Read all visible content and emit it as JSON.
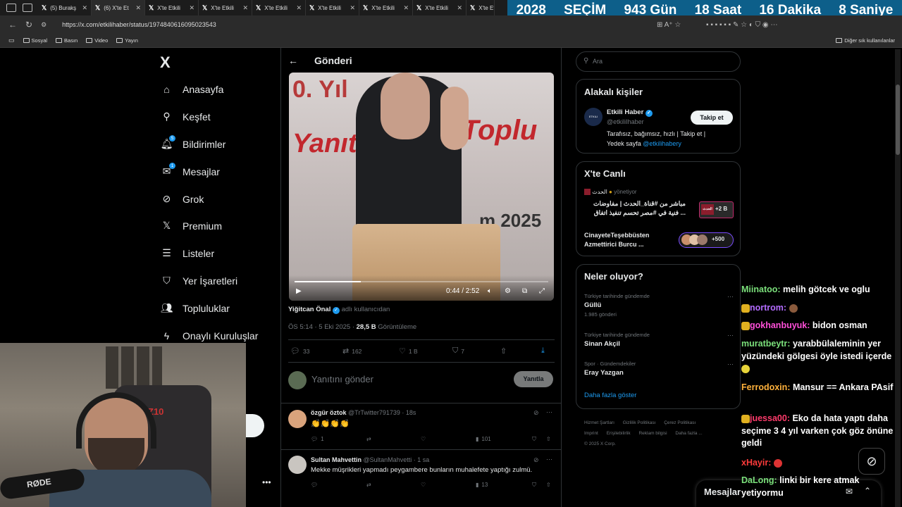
{
  "tabs": [
    {
      "label": "(5) Burakş"
    },
    {
      "label": "(6) X'te Et"
    },
    {
      "label": "X'te Etkili"
    },
    {
      "label": "X'te Etkili"
    },
    {
      "label": "X'te Etkili"
    },
    {
      "label": "X'te Etkili"
    },
    {
      "label": "X'te Etkili"
    },
    {
      "label": "X'te Etkili"
    },
    {
      "label": "X'te Etk"
    }
  ],
  "banner": {
    "year": "2028",
    "label": "SEÇİM",
    "days": "943 Gün",
    "hours": "18 Saat",
    "minutes": "16 Dakika",
    "seconds": "8 Saniye"
  },
  "browser": {
    "url": "https://x.com/etkilihaber/status/1974840616095023543"
  },
  "bookmarks": [
    "Sosyal",
    "Basın",
    "Video",
    "Yayın"
  ],
  "other_bookmarks": "Diğer sık kullanılanlar",
  "nav": {
    "logo": "X",
    "items": [
      {
        "label": "Anasayfa",
        "icon": "home-icon"
      },
      {
        "label": "Keşfet",
        "icon": "search-icon"
      },
      {
        "label": "Bildirimler",
        "icon": "bell-icon",
        "badge": "5"
      },
      {
        "label": "Mesajlar",
        "icon": "mail-icon",
        "badge": "1"
      },
      {
        "label": "Grok",
        "icon": "grok-icon"
      },
      {
        "label": "Premium",
        "icon": "x-icon"
      },
      {
        "label": "Listeler",
        "icon": "list-icon"
      },
      {
        "label": "Yer İşaretleri",
        "icon": "bookmark-icon"
      },
      {
        "label": "Topluluklar",
        "icon": "people-icon"
      },
      {
        "label": "Onaylı Kuruluşlar",
        "icon": "bolt-icon"
      }
    ]
  },
  "post": {
    "header": "Gönderi",
    "video_time": "0:44 / 2:52",
    "credit_name": "Yiğitcan Önal",
    "credit_suffix": "adlı kullanıcıdan",
    "timestamp": "ÖS 5:14 · 5 Eki 2025 ·",
    "views_count": "28,5 B",
    "views_label": "Görüntüleme",
    "stats": {
      "replies": "33",
      "reposts": "162",
      "likes": "1 B",
      "bookmarks": "7"
    },
    "reply_placeholder": "Yanıtını gönder",
    "reply_button": "Yanıtla"
  },
  "replies": [
    {
      "name": "özgür öztok",
      "handle": "@TrTwitter791739 · 18s",
      "text": "👏👏👏👏",
      "replies": "1",
      "views": "101"
    },
    {
      "name": "Sultan Mahvettin",
      "handle": "@SultanMahvetti · 1 sa",
      "text": "Mekke müşrikleri yapmadı peygambere bunların muhalefete yaptığı zulmü.",
      "replies": "",
      "views": "13"
    }
  ],
  "right": {
    "search_placeholder": "Ara",
    "relevant_title": "Alakalı kişiler",
    "account": {
      "name": "Etkili Haber",
      "handle": "@etkiliIhaber",
      "bio": "Tarafısız, bağımsız, hızlı | Takip et |",
      "bio2": "Yedek sayfa",
      "bio_link": "@etkilihabery",
      "follow": "Takip et",
      "avatar_text": "ETKILI HABER"
    },
    "live_title": "X'te Canlı",
    "live": [
      {
        "host": "الحدث",
        "role": "yönetiyor",
        "line1": "مباشر من #قناة_الحدث | مفاوضات",
        "line2": "... فنية في #مصر تحسم تنفيذ اتفاق",
        "count": "+2 B",
        "thumb_text": "الحدث"
      },
      {
        "line1": "CinayeteTeşebbüsten",
        "line2": "Azmettirici Burcu ...",
        "count": "+500"
      }
    ],
    "trends_title": "Neler oluyor?",
    "trends": [
      {
        "context": "Türkiye tarihinde gündemde",
        "name": "Güllü",
        "count": "1.985 gönderi"
      },
      {
        "context": "Türkiye tarihinde gündemde",
        "name": "Sinan Akçil",
        "count": ""
      },
      {
        "context": "Spor · Gündemdekiler",
        "name": "Eray Yazgan",
        "count": ""
      }
    ],
    "show_more": "Daha fazla göster",
    "footer": [
      "Hizmet Şartları",
      "Gizlilik Politikası",
      "Çerez Politikası",
      "Imprint",
      "Erişilebilirlik",
      "Reklam bilgisi",
      "Daha fazla ...",
      "© 2025 X Corp."
    ]
  },
  "messages_bar": "Mesajlar",
  "chat": [
    {
      "user": "Miinatoo:",
      "msg": "melih götcek ve oglu",
      "color": "#7be07b"
    },
    {
      "user": "nortrom:",
      "msg": "",
      "color": "#b46cff"
    },
    {
      "user": "gokhanbuyuk:",
      "msg": "bidon osman",
      "color": "#ff4fd8"
    },
    {
      "user": "muratbeytr:",
      "msg": "yarabbülaleminin yer yüzündeki gölgesi öyle istedi içerde",
      "color": "#7be07b"
    },
    {
      "user": "Ferrodoxin:",
      "msg": "Mansur == Ankara PAsif",
      "color": "#ffb13b"
    },
    {
      "user": "juessa00:",
      "msg": "Eko da hata yaptı daha seçime 3 4 yıl varken çok göz önüne geldi",
      "color": "#ff3b6b"
    },
    {
      "user": "xHayir:",
      "msg": "",
      "color": "#ff3b3b"
    },
    {
      "user": "DaLong:",
      "msg": "linki bir kere atmak yetiyormu",
      "color": "#7be07b"
    }
  ]
}
